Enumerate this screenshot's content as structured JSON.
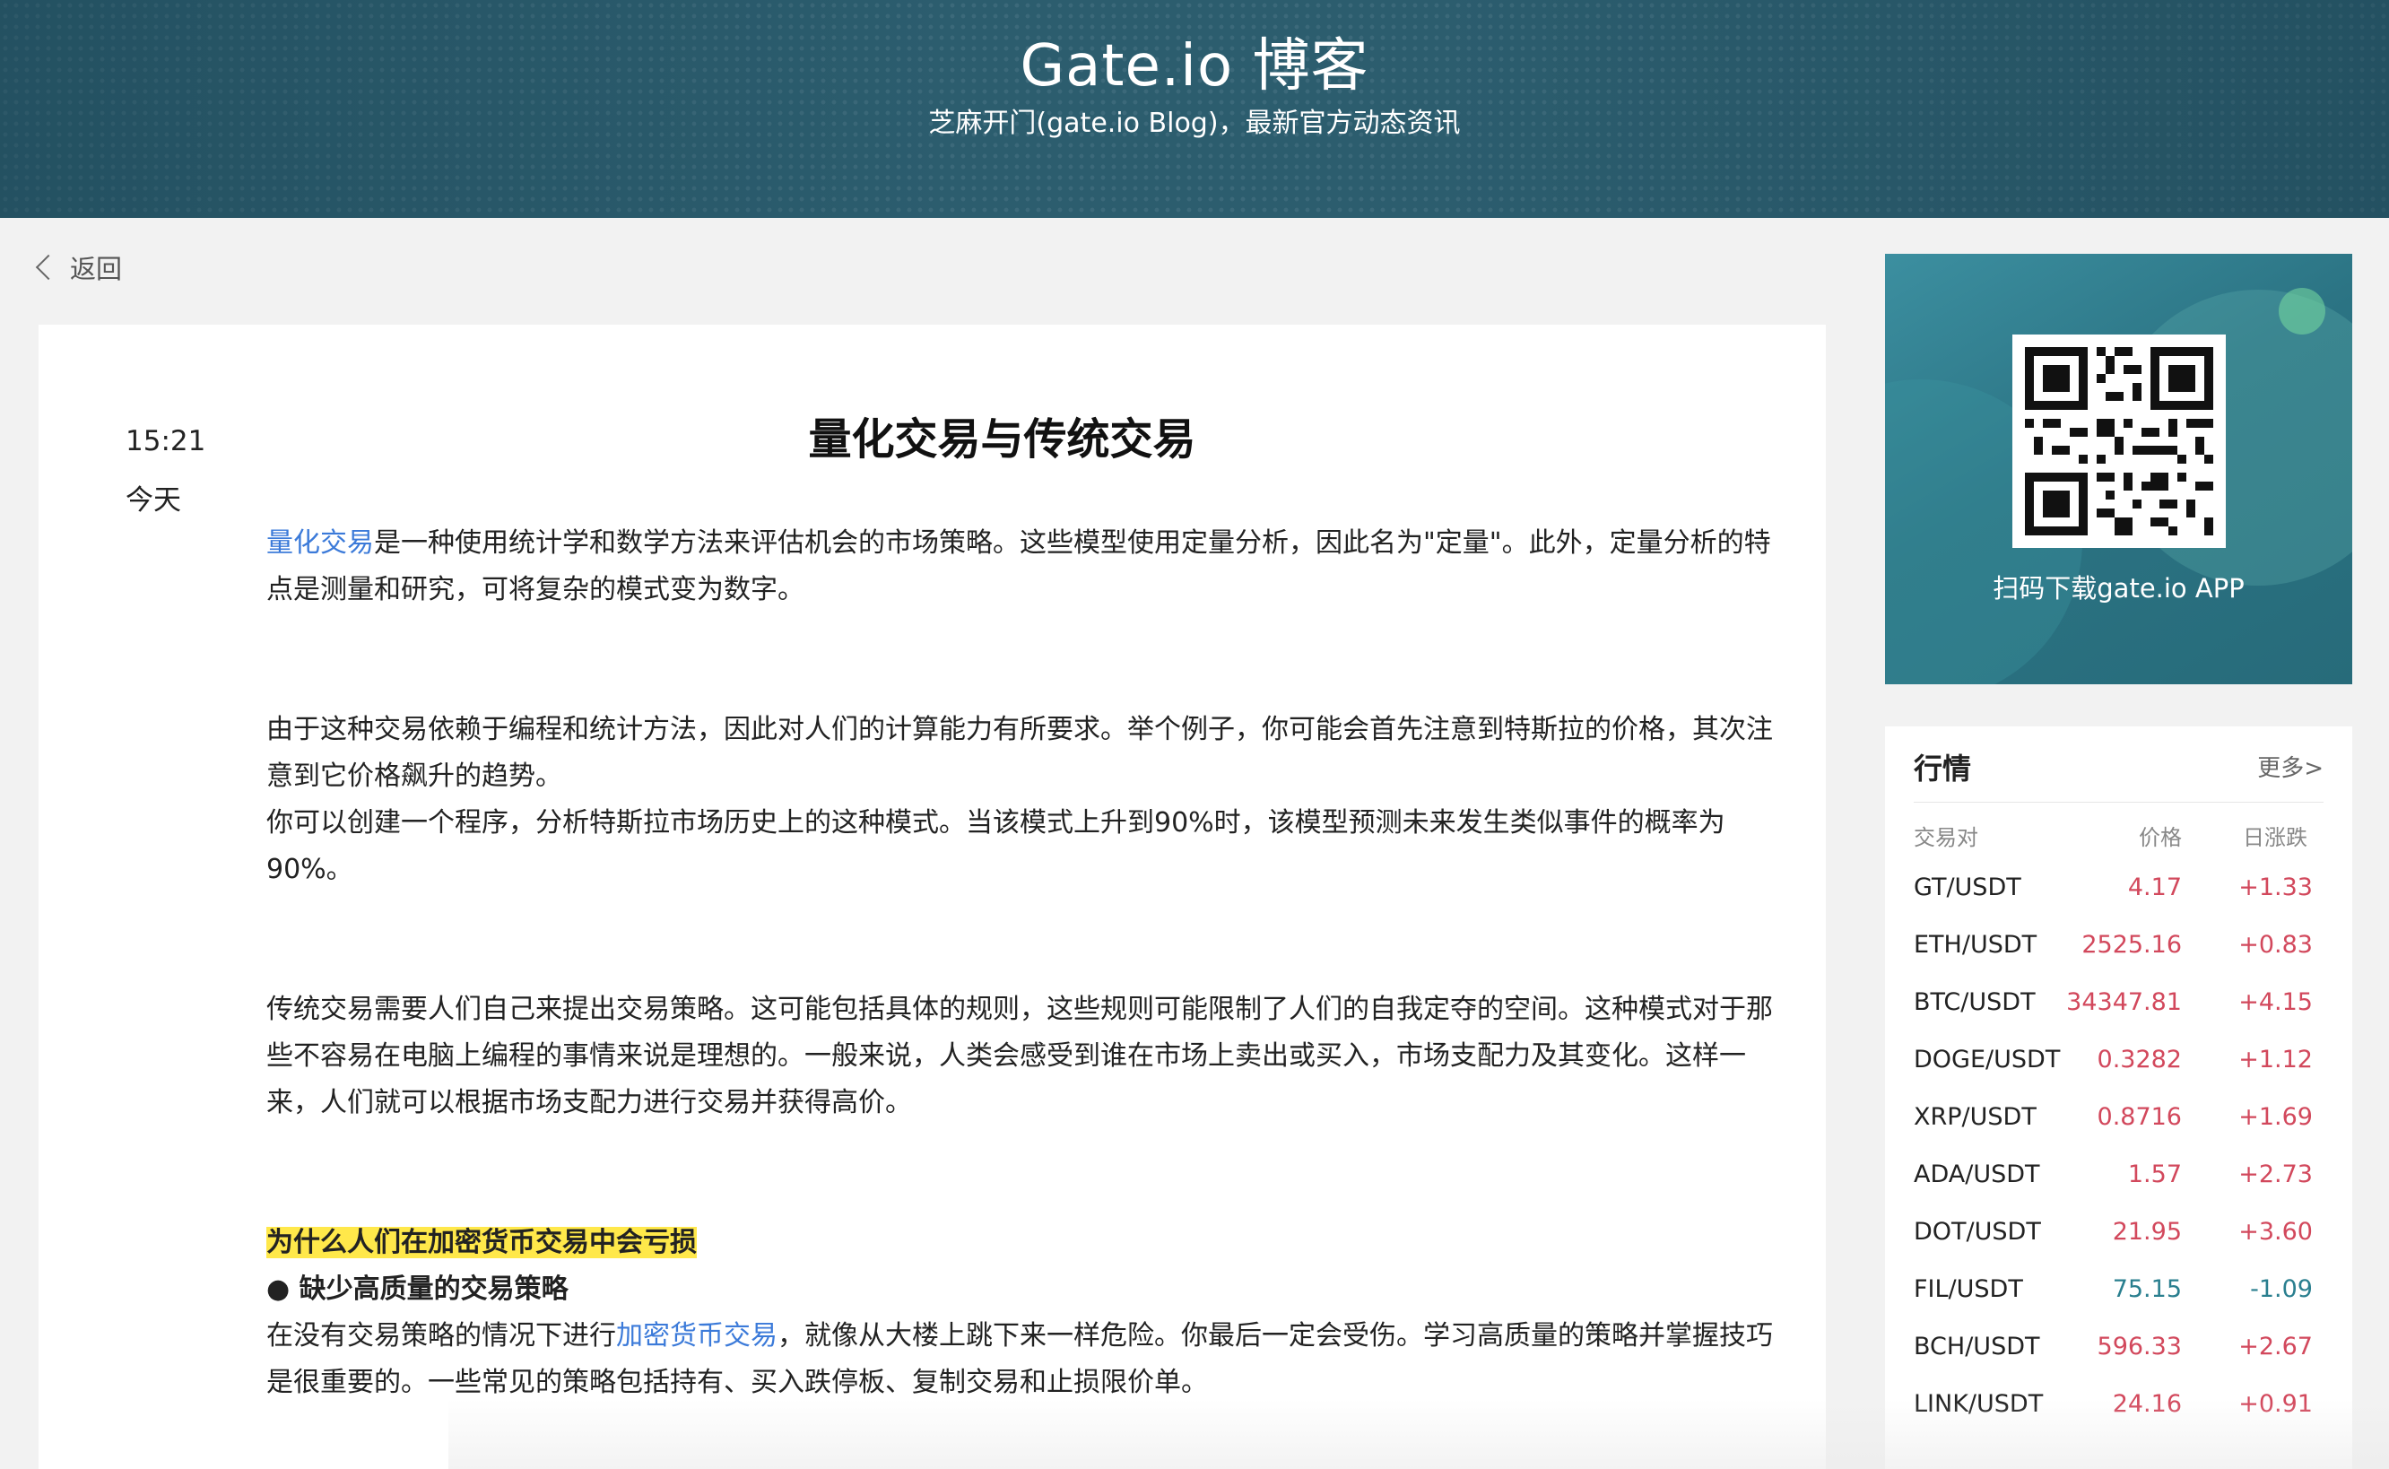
{
  "header": {
    "title": "Gate.io 博客",
    "subtitle": "芝麻开门(gate.io Blog)，最新官方动态资讯"
  },
  "nav": {
    "back_label": "返回"
  },
  "article": {
    "time": "15:21",
    "date": "今天",
    "title": "量化交易与传统交易",
    "p1_link": "量化交易",
    "p1_rest": "是一种使用统计学和数学方法来评估机会的市场策略。这些模型使用定量分析，因此名为\"定量\"。此外，定量分析的特点是测量和研究，可将复杂的模式变为数字。",
    "p2_line1": "由于这种交易依赖于编程和统计方法，因此对人们的计算能力有所要求。举个例子，你可能会首先注意到特斯拉的价格，其次注意到它价格飙升的趋势。",
    "p2_line2": "你可以创建一个程序，分析特斯拉市场历史上的这种模式。当该模式上升到90%时，该模型预测未来发生类似事件的概率为90%。",
    "p3": "传统交易需要人们自己来提出交易策略。这可能包括具体的规则，这些规则可能限制了人们的自我定夺的空间。这种模式对于那些不容易在电脑上编程的事情来说是理想的。一般来说，人类会感受到谁在市场上卖出或买入，市场支配力及其变化。这样一来，人们就可以根据市场支配力进行交易并获得高价。",
    "section_heading": "为什么人们在加密货币交易中会亏损",
    "bullet_heading": "● 缺少高质量的交易策略",
    "p4_pre": "在没有交易策略的情况下进行",
    "p4_link": "加密货币交易",
    "p4_post": "，就像从大楼上跳下来一样危险。你最后一定会受伤。学习高质量的策略并掌握技巧是很重要的。一些常见的策略包括持有、买入跌停板、复制交易和止损限价单。"
  },
  "app_promo": {
    "caption": "扫码下载gate.io APP"
  },
  "market": {
    "title": "行情",
    "more": "更多>",
    "columns": [
      "交易对",
      "价格",
      "日涨跌"
    ],
    "rows": [
      {
        "pair": "GT/USDT",
        "price": "4.17",
        "change": "+1.33"
      },
      {
        "pair": "ETH/USDT",
        "price": "2525.16",
        "change": "+0.83"
      },
      {
        "pair": "BTC/USDT",
        "price": "34347.81",
        "change": "+4.15"
      },
      {
        "pair": "DOGE/USDT",
        "price": "0.3282",
        "change": "+1.12"
      },
      {
        "pair": "XRP/USDT",
        "price": "0.8716",
        "change": "+1.69"
      },
      {
        "pair": "ADA/USDT",
        "price": "1.57",
        "change": "+2.73"
      },
      {
        "pair": "DOT/USDT",
        "price": "21.95",
        "change": "+3.60"
      },
      {
        "pair": "FIL/USDT",
        "price": "75.15",
        "change": "-1.09"
      },
      {
        "pair": "BCH/USDT",
        "price": "596.33",
        "change": "+2.67"
      },
      {
        "pair": "LINK/USDT",
        "price": "24.16",
        "change": "+0.91"
      }
    ],
    "up_color": "#d2485c",
    "down_color": "#2a7f8f"
  },
  "colors": {
    "banner": "#2d5e6f",
    "link": "#3b7ad9",
    "highlight": "#ffe84a"
  }
}
